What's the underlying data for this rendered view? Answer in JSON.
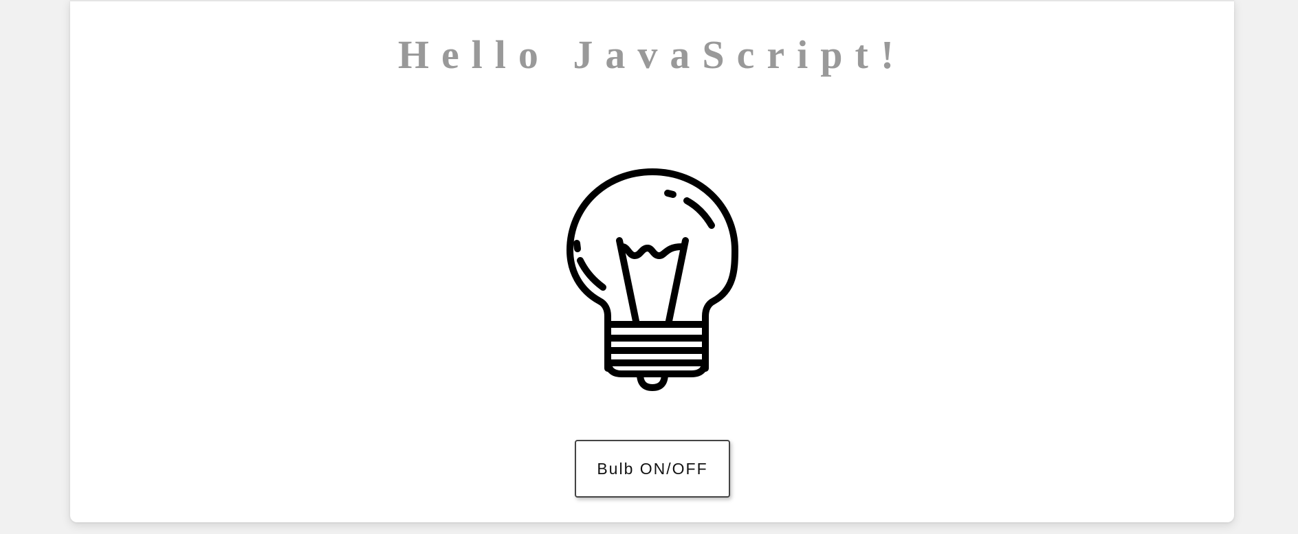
{
  "page": {
    "title": "Hello JavaScript!"
  },
  "bulb": {
    "icon": "light-bulb-icon",
    "state": "off"
  },
  "controls": {
    "toggle_label": "Bulb ON/OFF"
  },
  "colors": {
    "background": "#f1f1f1",
    "card": "#ffffff",
    "title": "#999999",
    "icon_stroke": "#000000"
  }
}
